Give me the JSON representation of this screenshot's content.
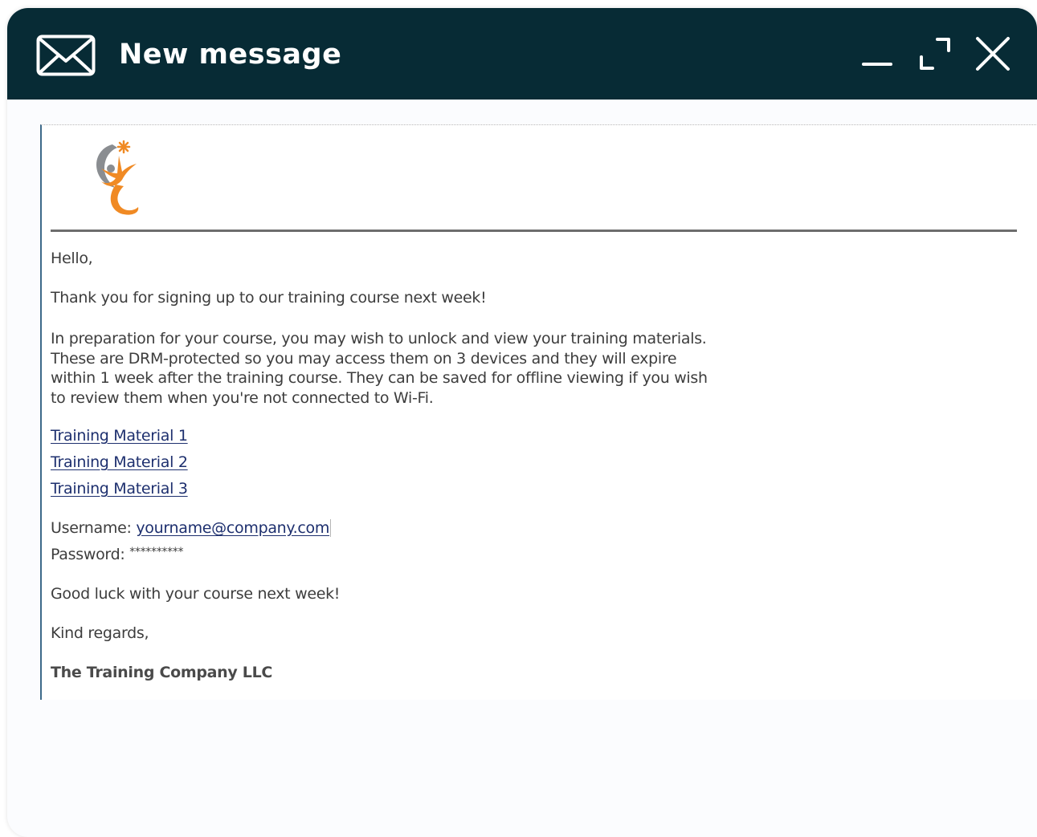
{
  "window": {
    "title": "New message",
    "icons": {
      "mail": "envelope-icon",
      "minimize": "minimize-icon",
      "maximize": "expand-icon",
      "close": "close-icon"
    },
    "colors": {
      "titlebar": "#072b35",
      "link": "#1d2f6e"
    }
  },
  "email": {
    "logo": "company-logo",
    "greeting": "Hello,",
    "intro": "Thank you for signing up to our training course next week!",
    "paragraph_lines": [
      "In preparation for your course, you may wish to unlock and view your training materials.",
      "These are DRM-protected so you may access them on 3 devices and they will expire",
      "within 1 week after the training course. They can be saved for offline viewing if you wish",
      "to review them when you're not connected to Wi-Fi."
    ],
    "links": [
      "Training Material 1",
      "Training Material 2",
      "Training Material 3"
    ],
    "username_label": "Username:",
    "username_value": "yourname@company.com",
    "password_label": "Password:",
    "password_value": "**********",
    "closing": "Good luck with your course next week!",
    "regards": "Kind regards,",
    "signature": "The Training Company LLC"
  }
}
